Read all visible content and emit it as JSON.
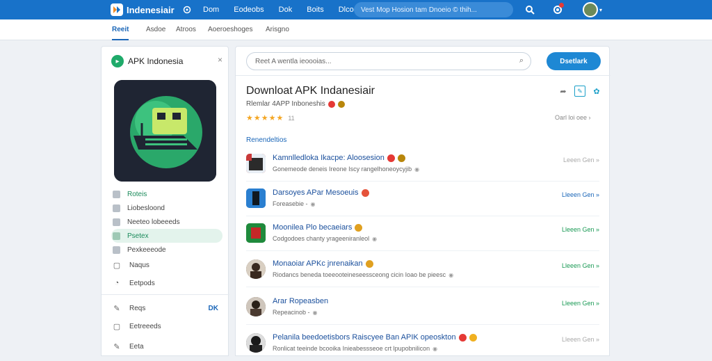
{
  "topbar": {
    "brand": "Indenesiair",
    "nav": [
      "Dom",
      "Eodeobs",
      "Dok",
      "Boits",
      "Dlcoeolo"
    ],
    "search_text": "Vest Mop Hosion tam  Dnoeio © thih...",
    "colors": {
      "bar": "#1872c9"
    }
  },
  "tabs": [
    "Reeit",
    "Asdoe",
    "Atroos",
    "Aoeroeshoges",
    "Arisgno"
  ],
  "sidebar": {
    "title": "APK Indonesia",
    "close": "×",
    "items": [
      {
        "label": "Roteis",
        "icon": "square-icon",
        "state": "green"
      },
      {
        "label": "Liobesloond",
        "icon": "square-icon",
        "state": "normal"
      },
      {
        "label": "Neeteo lobeeeds",
        "icon": "square-icon",
        "state": "normal"
      },
      {
        "label": "Psetex",
        "icon": "square-icon",
        "state": "active"
      },
      {
        "label": "Pexkeeeode",
        "icon": "square-icon",
        "state": "normal"
      }
    ],
    "items2": [
      {
        "label": "Naqus",
        "icon": "chat-icon",
        "glyph": "▢"
      },
      {
        "label": "Eetpods",
        "icon": "info-icon",
        "glyph": "◔"
      },
      {
        "label": "Reqs",
        "icon": "pen-icon",
        "glyph": "✎",
        "right": "DK"
      },
      {
        "label": "Eetreeeds",
        "icon": "doc-icon",
        "glyph": "▢"
      },
      {
        "label": "Eeta",
        "icon": "pen-icon",
        "glyph": "✎"
      }
    ]
  },
  "main": {
    "search_placeholder": "Reet A wentla ieoooias...",
    "download_button": "Dsetlark",
    "title": "Downloat APK Indanesiair",
    "subtitle": "Rlemlar 4APP Inboneshis",
    "rating_stars": "★★★★★",
    "rating_count": "11",
    "see_all": "Oarl loi oee ›",
    "section_title": "Renendeltios",
    "rows": [
      {
        "title": "Kamnlledloka Ikacpe: Aloosesion",
        "desc": "Gonemeode deneis Ireone Iscy rangelhoneoycyjib",
        "link": "Leeen Gen »",
        "link_color": "gray",
        "badges": [
          "#e53935",
          "#b8860b"
        ]
      },
      {
        "title": "Darsoyes APar Mesoeuis",
        "desc": "Foreasebie -",
        "link": "Lleeen Gen »",
        "link_color": "blue",
        "badges": [
          "#e5533a"
        ]
      },
      {
        "title": "Moonilea Plo becaeiars",
        "desc": "Codgodoes chanty yrageeniranleol",
        "link": "Lleeen Gen »",
        "link_color": "green",
        "badges": [
          "#e0a020"
        ]
      },
      {
        "title": "Monaoiar APKc jnrenaikan",
        "desc": "Riodancs beneda toeeooteineseessceong cicin Ioao be pieesc",
        "link": "Lleeen Gen »",
        "link_color": "green",
        "badges": [
          "#e0a020"
        ]
      },
      {
        "title": "Arar Ropeasben",
        "desc": "Repeacinob -",
        "link": "Lleeen Gen »",
        "link_color": "green",
        "badges": []
      },
      {
        "title": "Pelanila beedoetisbors Raiscyee Ban APIK opeoskton",
        "desc": "Ronlicat teeinde bcooika Inieabessseoe crt lpupobnilicon",
        "link": "Lleeen Gen »",
        "link_color": "gray",
        "badges": [
          "#e53935",
          "#f0b020"
        ]
      }
    ]
  }
}
